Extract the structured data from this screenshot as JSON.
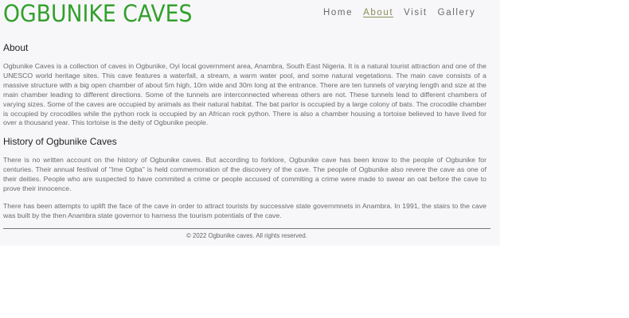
{
  "header": {
    "title": "OGBUNIKE CAVES",
    "title_color": "#33a02c",
    "nav": [
      {
        "label": "Home",
        "active": false
      },
      {
        "label": "About",
        "active": true
      },
      {
        "label": "Visit",
        "active": false
      },
      {
        "label": "Gallery",
        "active": false
      }
    ]
  },
  "about": {
    "heading": "About",
    "paragraph": "Ogbunike Caves is a collection of caves in Ogbunike, Oyi local government area, Anambra, South East Nigeria. It is a natural tourist attraction and one of the UNESCO world heritage sites. This cave features a waterfall, a stream, a warm water pool, and some natural vegetations. The main cave consists of a massive structure with a big open chamber of about 5m high, 10m wide and 30m long at the entrance. There are ten tunnels of varying length and size at the main chamber leading to different directions. Some of the tunnels are interconnected whereas others are not. These tunnels lead to different chambers of varying sizes. Some of the caves are occupied by animals as their natural habitat. The bat parlor is occupied by a large colony of bats. The crocodile chamber is occupied by crocodiles while the python rock is occupied by an African rock python. There is also a chamber housing a tortoise believed to have lived for over a thousand year. This tortoise is the deity of Ogbunike people."
  },
  "history": {
    "heading": "History of Ogbunike Caves",
    "paragraphs": [
      "There is no written account on the history of Ogbunike caves. But according to forklore, Ogbunike cave has been know to the people of Ogbunike for centuries. Their annual festival of \"Ime Ogba\" is held commemoration of the discovery of the cave. The people of Ogbunike also revere the cave as one of their deities. People who are suspected to have commited a crime or people accused of commiting a crime were made to swear an oat before the cave to prove their innocence.",
      "There has been attempts to uplift the face of the cave in order to attract tourists by successive state governmnets in Anambra. In 1991, the stairs to the cave was built by the then Anambra state governor to harness the tourism potentials of the cave."
    ]
  },
  "footer": {
    "copyright": "© 2022 Ogbunike caves. All rights reserved."
  }
}
